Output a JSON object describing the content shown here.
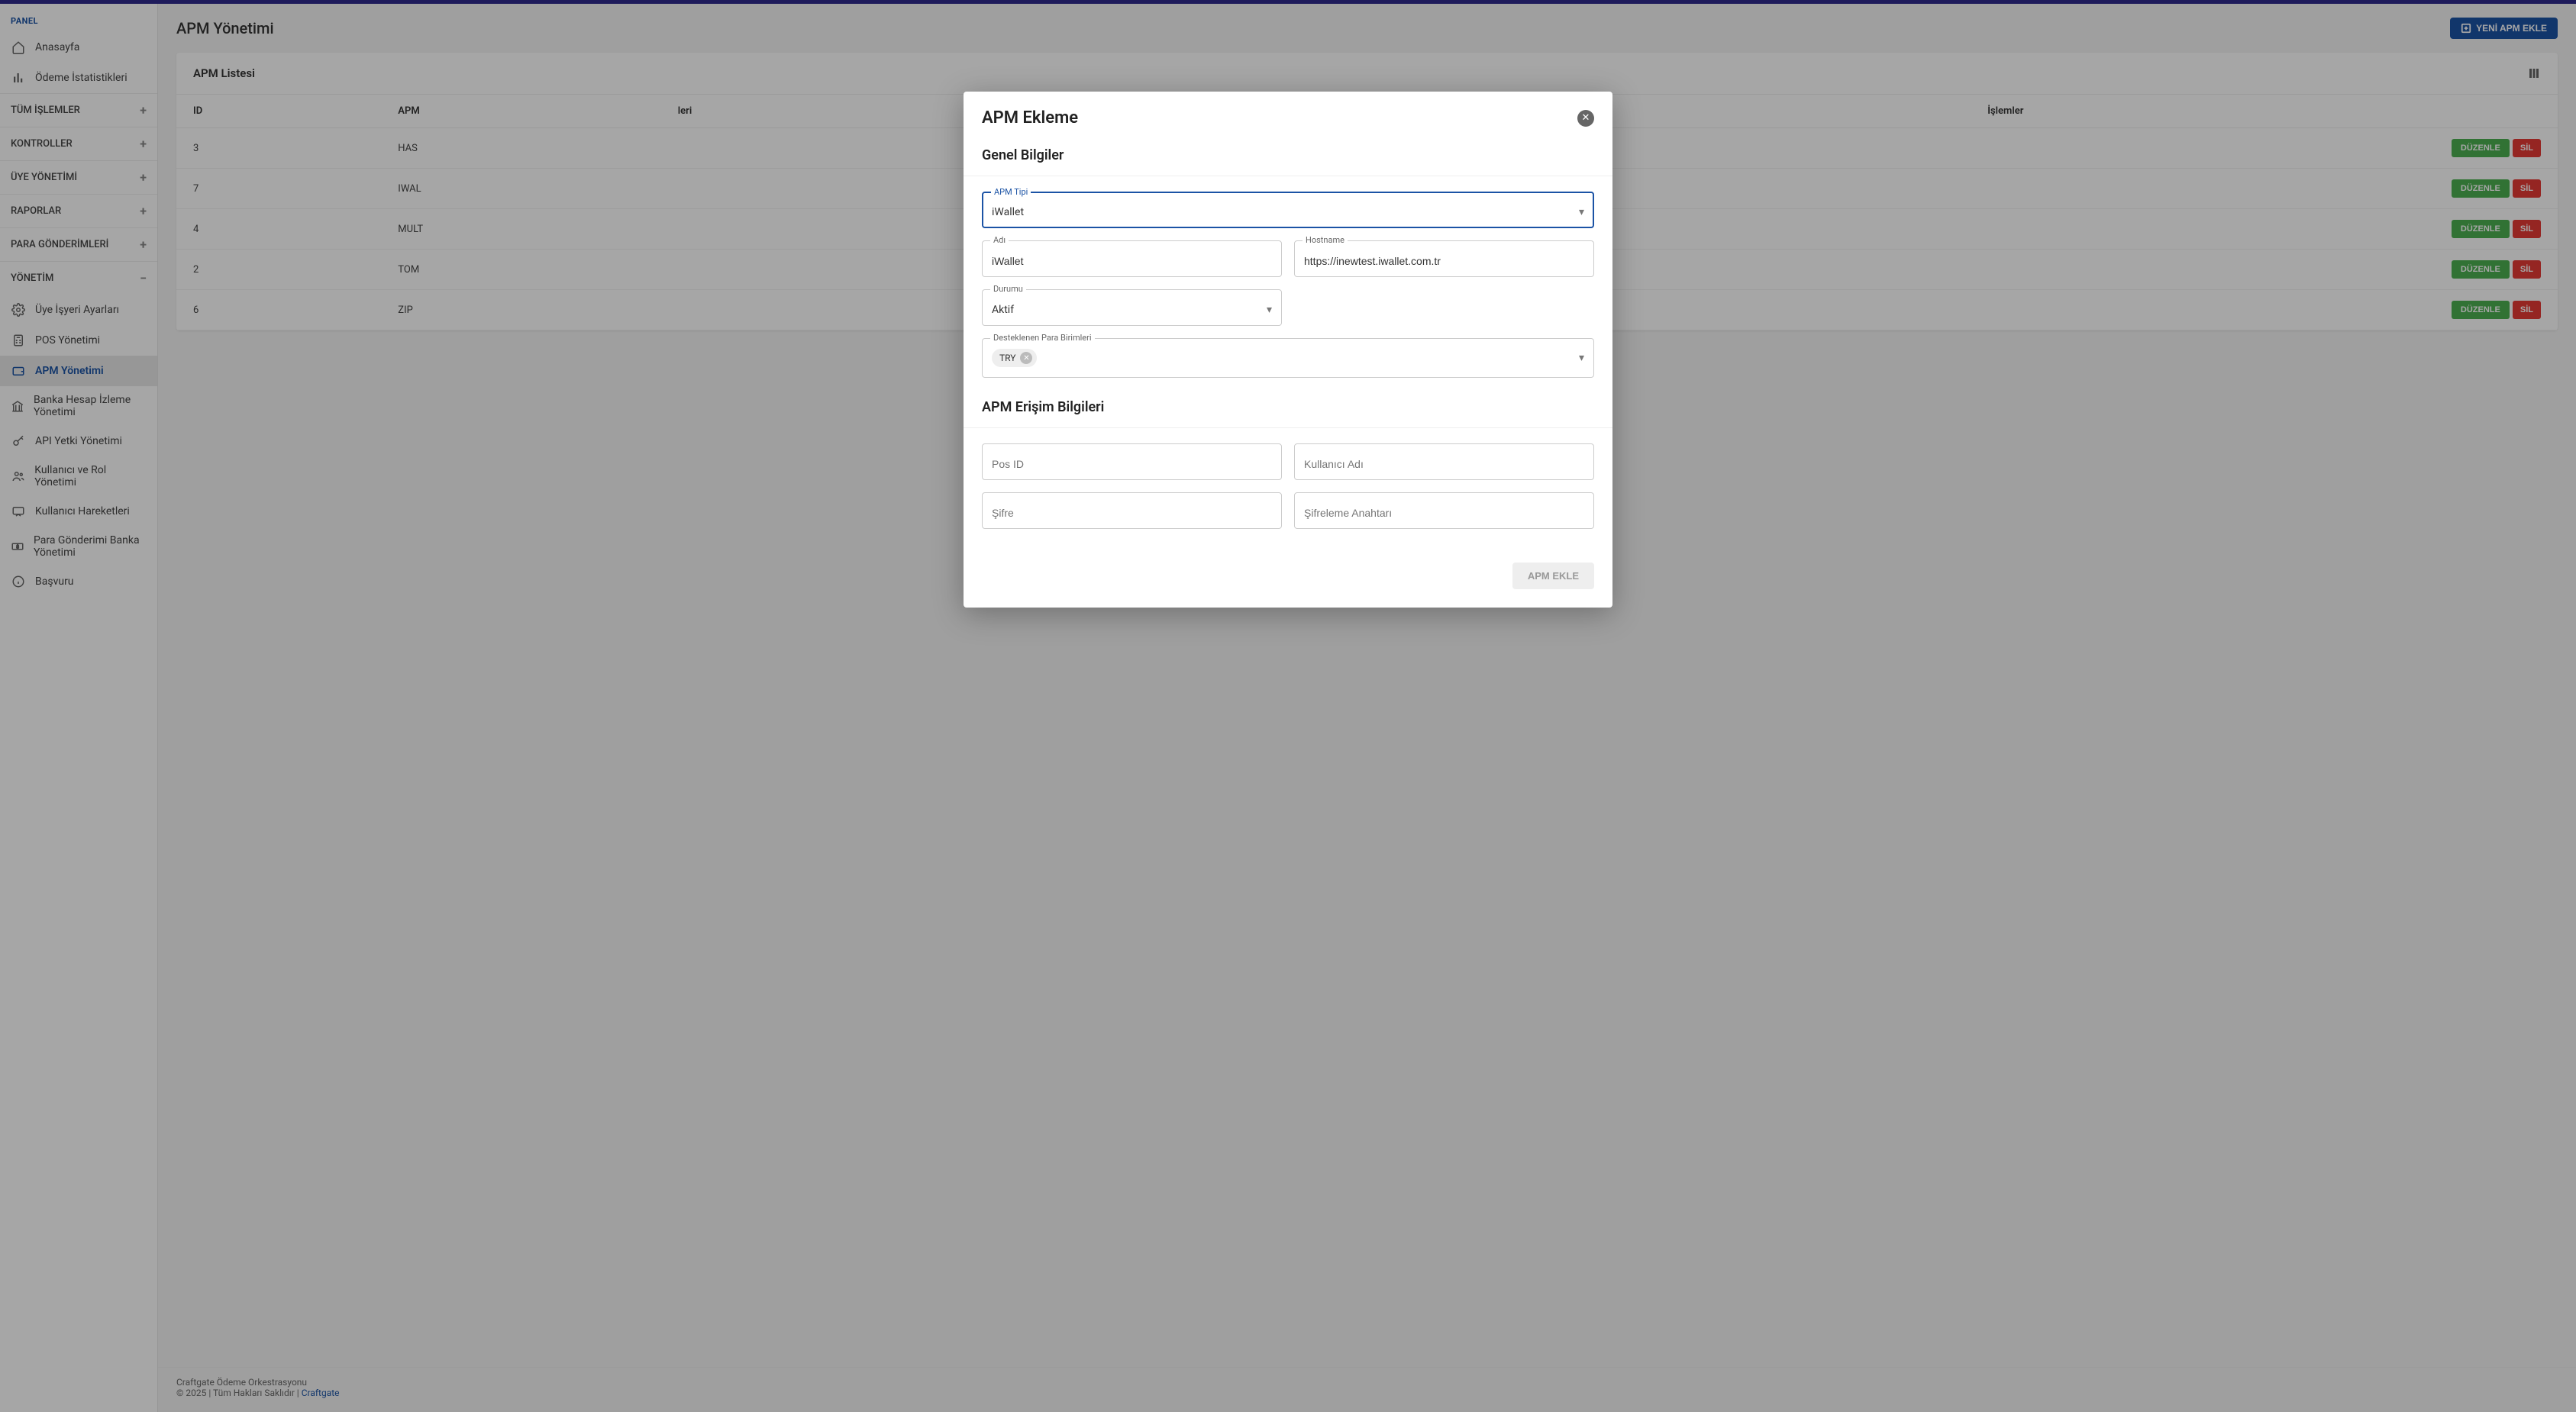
{
  "sidebar": {
    "panel_label": "PANEL",
    "items_panel": [
      {
        "label": "Anasayfa"
      },
      {
        "label": "Ödeme İstatistikleri"
      }
    ],
    "groups": [
      {
        "label": "TÜM İŞLEMLER",
        "expanded": false
      },
      {
        "label": "KONTROLLER",
        "expanded": false
      },
      {
        "label": "ÜYE YÖNETİMİ",
        "expanded": false
      },
      {
        "label": "RAPORLAR",
        "expanded": false
      },
      {
        "label": "PARA GÖNDERİMLERİ",
        "expanded": false
      },
      {
        "label": "YÖNETİM",
        "expanded": true
      }
    ],
    "yonetim_items": [
      {
        "label": "Üye İşyeri Ayarları"
      },
      {
        "label": "POS Yönetimi"
      },
      {
        "label": "APM Yönetimi"
      },
      {
        "label": "Banka Hesap İzleme Yönetimi"
      },
      {
        "label": "API Yetki Yönetimi"
      },
      {
        "label": "Kullanıcı ve Rol Yönetimi"
      },
      {
        "label": "Kullanıcı Hareketleri"
      },
      {
        "label": "Para Gönderimi Banka Yönetimi"
      },
      {
        "label": "Başvuru"
      }
    ]
  },
  "page": {
    "title": "APM Yönetimi",
    "add_button": "YENİ APM EKLE"
  },
  "list": {
    "title": "APM Listesi",
    "columns": {
      "id": "ID",
      "apm": "APM",
      "info": "leri",
      "actions": "İşlemler"
    },
    "edit_label": "DÜZENLE",
    "delete_label": "SİL",
    "rows": [
      {
        "id": "3",
        "apm": "HAS"
      },
      {
        "id": "7",
        "apm": "IWAL"
      },
      {
        "id": "4",
        "apm": "MULT"
      },
      {
        "id": "2",
        "apm": "TOM"
      },
      {
        "id": "6",
        "apm": "ZIP"
      }
    ]
  },
  "footer": {
    "line1": "Craftgate Ödeme Orkestrasyonu",
    "line2_prefix": "© 2025 | Tüm Hakları Saklıdır | ",
    "link": "Craftgate"
  },
  "modal": {
    "title": "APM Ekleme",
    "section_general": "Genel Bilgiler",
    "section_access": "APM Erişim Bilgileri",
    "fields": {
      "apm_type": {
        "label": "APM Tipi",
        "value": "iWallet"
      },
      "name": {
        "label": "Adı",
        "value": "iWallet"
      },
      "hostname": {
        "label": "Hostname",
        "value": "https://inewtest.iwallet.com.tr"
      },
      "status": {
        "label": "Durumu",
        "value": "Aktif"
      },
      "currencies": {
        "label": "Desteklenen Para Birimleri",
        "chip": "TRY"
      },
      "pos_id": {
        "placeholder": "Pos ID"
      },
      "username": {
        "placeholder": "Kullanıcı Adı"
      },
      "password": {
        "placeholder": "Şifre"
      },
      "enc_key": {
        "placeholder": "Şifreleme Anahtarı"
      }
    },
    "submit": "APM EKLE"
  }
}
